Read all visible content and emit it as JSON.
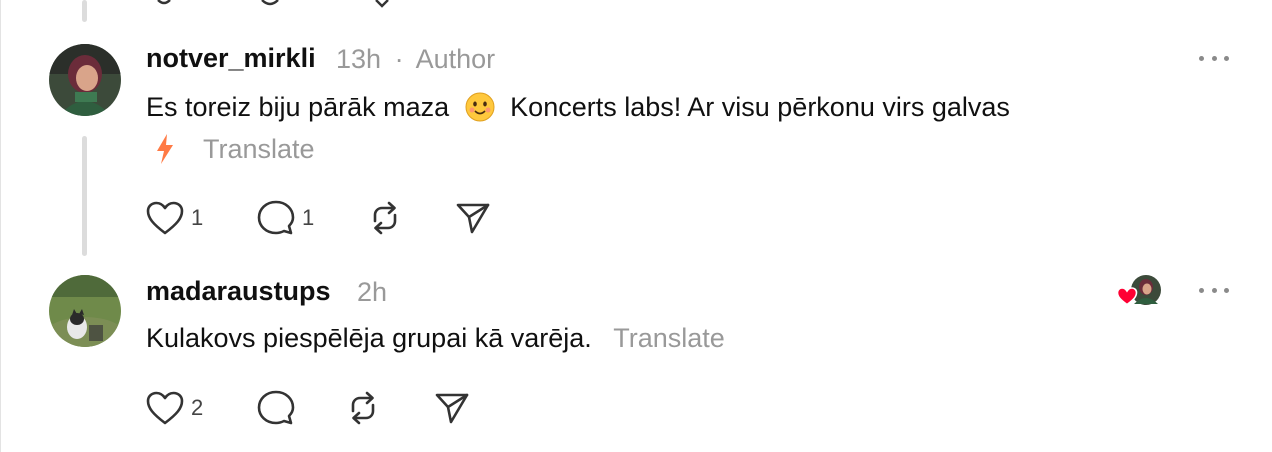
{
  "comments": [
    {
      "username": "notver_mirkli",
      "time": "13h",
      "separator": "·",
      "author_label": "Author",
      "text_before_emoji": "Es toreiz biju pārāk maza",
      "text_after_emoji": "Koncerts labs! Ar visu pērkonu virs galvas",
      "translate_label": "Translate",
      "likes": "1",
      "replies": "1"
    },
    {
      "username": "madaraustups",
      "time": "2h",
      "text": "Kulakovs piespēlēja grupai kā varēja.",
      "translate_label": "Translate",
      "likes": "2"
    }
  ],
  "colors": {
    "muted": "#999999",
    "heart_red": "#ff0033",
    "thread_line": "#dcdcdc",
    "lightning": "#ff7a45"
  }
}
